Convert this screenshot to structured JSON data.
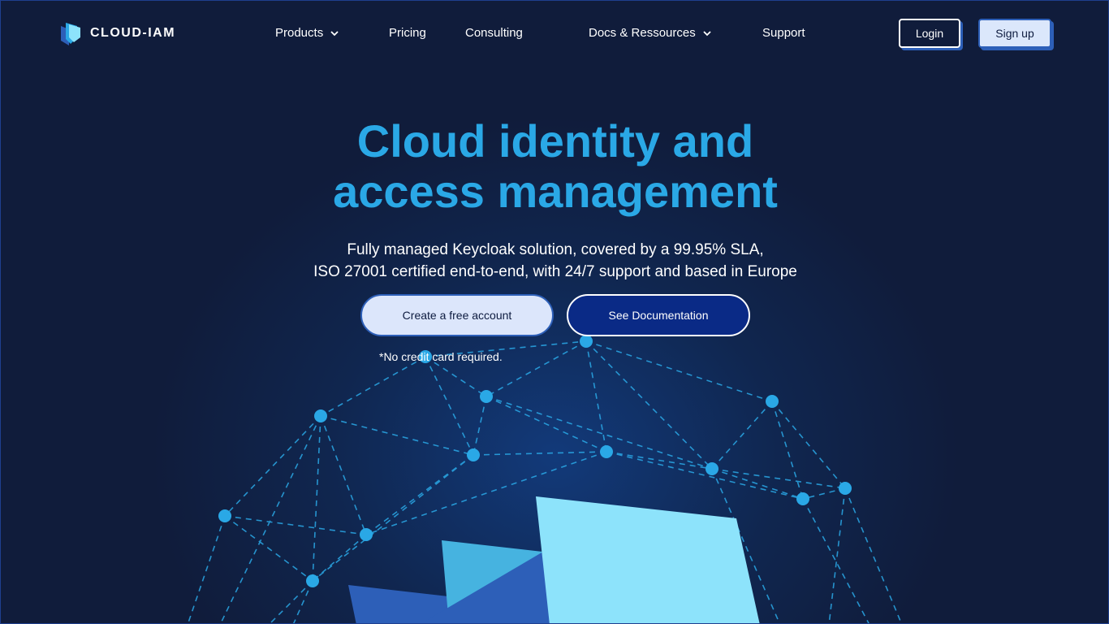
{
  "brand": {
    "name": "CLOUD-IAM"
  },
  "nav": {
    "items": [
      {
        "label": "Products",
        "has_dropdown": true
      },
      {
        "label": "Pricing",
        "has_dropdown": false
      },
      {
        "label": "Consulting",
        "has_dropdown": false
      },
      {
        "label": "Docs & Ressources",
        "has_dropdown": true
      },
      {
        "label": "Support",
        "has_dropdown": false
      }
    ],
    "login_label": "Login",
    "signup_label": "Sign up"
  },
  "hero": {
    "title_line1": "Cloud identity and",
    "title_line2": "access management",
    "subtitle_line1": "Fully managed Keycloak solution, covered by a 99.95% SLA,",
    "subtitle_line2": "ISO 27001 certified end-to-end, with 24/7 support and based in Europe",
    "cta_primary": "Create a free account",
    "cta_secondary": "See Documentation",
    "note": "*No credit card required."
  },
  "colors": {
    "background": "#101c3b",
    "accent": "#2aa8e6",
    "primary_button": "#dce6fb",
    "secondary_button": "#0a2a86",
    "node": "#2aa8e6"
  },
  "icons": {
    "logo": "cloud-iam-shield-logo",
    "dropdown": "chevron-down-icon"
  }
}
